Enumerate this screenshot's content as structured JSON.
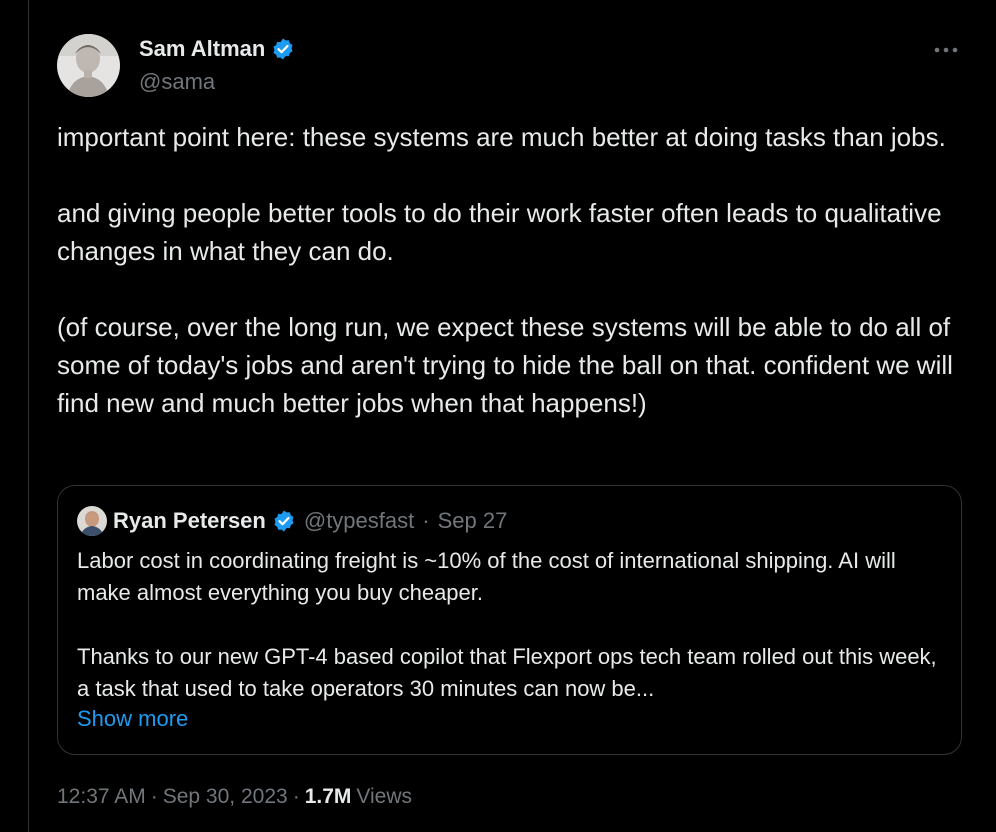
{
  "tweet": {
    "author": {
      "display_name": "Sam Altman",
      "handle": "@sama",
      "verified_icon": "verified-badge-icon",
      "avatar_icon": "avatar"
    },
    "more_icon": "more-icon",
    "paragraphs": [
      "important point here: these systems are much better at doing tasks than jobs.",
      "and giving people better tools to do their work faster often leads to qualitative changes in what they can do.",
      "(of course, over the long run, we expect these systems will be able to do all of some of today's jobs and aren't trying to hide the ball on that. confident we will find new and much better jobs when that happens!)"
    ],
    "quoted": {
      "display_name": "Ryan Petersen",
      "handle": "@typesfast",
      "separator": "·",
      "date": "Sep 27",
      "paragraphs": [
        "Labor cost in coordinating freight is ~10% of the cost of international shipping. AI will make almost everything you buy cheaper.",
        "Thanks to our new GPT-4 based copilot that Flexport ops tech team rolled out this week, a task that used to take operators 30 minutes can now be..."
      ],
      "show_more": "Show more"
    },
    "footer": {
      "time": "12:37 AM",
      "sep1": "·",
      "date": "Sep 30, 2023",
      "sep2": "·",
      "views_count": "1.7M",
      "views_label": "Views"
    }
  },
  "colors": {
    "background": "#000000",
    "text": "#e7e9ea",
    "muted": "#71767b",
    "accent": "#1d9bf0",
    "border": "#2f3336"
  }
}
